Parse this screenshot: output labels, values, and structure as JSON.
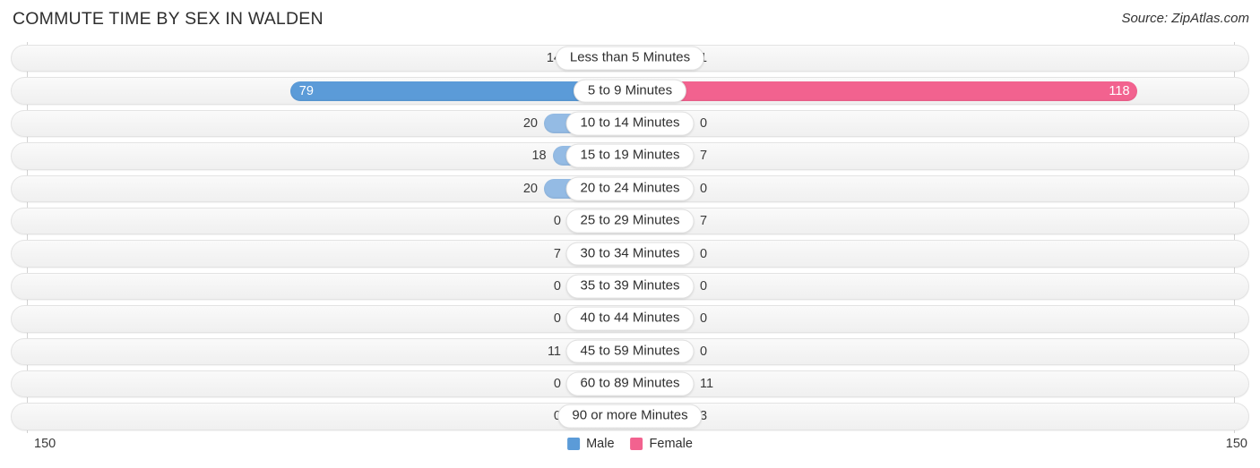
{
  "header": {
    "title": "COMMUTE TIME BY SEX IN WALDEN",
    "source": "Source: ZipAtlas.com"
  },
  "axis": {
    "left_tick": "150",
    "right_tick": "150",
    "max": 150
  },
  "legend": {
    "items": [
      {
        "label": "Male",
        "color": "#5b9bd8"
      },
      {
        "label": "Female",
        "color": "#f2628f"
      }
    ]
  },
  "colors": {
    "male_strong": "#5b9bd8",
    "male_light": "#94bbe4",
    "female_strong": "#f2628f",
    "female_light": "#f8a8c0",
    "track": "#f4f4f4",
    "track_border": "#e3e3e3"
  },
  "chart_data": {
    "type": "bar",
    "orientation": "horizontal-diverging",
    "title": "COMMUTE TIME BY SEX IN WALDEN",
    "xlabel": "",
    "ylabel": "",
    "xlim": [
      150,
      150
    ],
    "grid": false,
    "legend_position": "bottom-center",
    "categories": [
      "Less than 5 Minutes",
      "5 to 9 Minutes",
      "10 to 14 Minutes",
      "15 to 19 Minutes",
      "20 to 24 Minutes",
      "25 to 29 Minutes",
      "30 to 34 Minutes",
      "35 to 39 Minutes",
      "40 to 44 Minutes",
      "45 to 59 Minutes",
      "60 to 89 Minutes",
      "90 or more Minutes"
    ],
    "series": [
      {
        "name": "Male",
        "values": [
          14,
          79,
          20,
          18,
          20,
          0,
          7,
          0,
          0,
          11,
          0,
          0
        ]
      },
      {
        "name": "Female",
        "values": [
          1,
          118,
          0,
          7,
          0,
          7,
          0,
          0,
          0,
          0,
          11,
          3
        ]
      }
    ]
  },
  "rows": [
    {
      "category": "Less than 5 Minutes",
      "male": "14",
      "female": "1",
      "male_value": 14,
      "female_value": 1
    },
    {
      "category": "5 to 9 Minutes",
      "male": "79",
      "female": "118",
      "male_value": 79,
      "female_value": 118
    },
    {
      "category": "10 to 14 Minutes",
      "male": "20",
      "female": "0",
      "male_value": 20,
      "female_value": 0
    },
    {
      "category": "15 to 19 Minutes",
      "male": "18",
      "female": "7",
      "male_value": 18,
      "female_value": 7
    },
    {
      "category": "20 to 24 Minutes",
      "male": "20",
      "female": "0",
      "male_value": 20,
      "female_value": 0
    },
    {
      "category": "25 to 29 Minutes",
      "male": "0",
      "female": "7",
      "male_value": 0,
      "female_value": 7
    },
    {
      "category": "30 to 34 Minutes",
      "male": "7",
      "female": "0",
      "male_value": 7,
      "female_value": 0
    },
    {
      "category": "35 to 39 Minutes",
      "male": "0",
      "female": "0",
      "male_value": 0,
      "female_value": 0
    },
    {
      "category": "40 to 44 Minutes",
      "male": "0",
      "female": "0",
      "male_value": 0,
      "female_value": 0
    },
    {
      "category": "45 to 59 Minutes",
      "male": "11",
      "female": "0",
      "male_value": 11,
      "female_value": 0
    },
    {
      "category": "60 to 89 Minutes",
      "male": "0",
      "female": "11",
      "male_value": 0,
      "female_value": 11
    },
    {
      "category": "90 or more Minutes",
      "male": "0",
      "female": "3",
      "male_value": 0,
      "female_value": 3
    }
  ]
}
